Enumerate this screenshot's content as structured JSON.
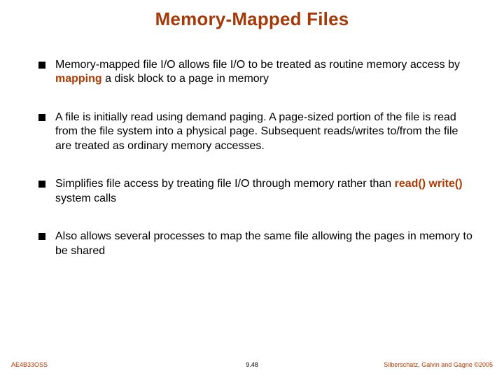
{
  "title": "Memory-Mapped Files",
  "bullets": {
    "b1a": "Memory-mapped file I/O allows file I/O to be treated as routine memory access by ",
    "b1kw": "mapping",
    "b1b": " a disk block to a page in memory",
    "b2": "A file is initially read using demand paging. A page-sized portion of the file is read from the file system into a physical page. Subsequent reads/writes to/from the file are treated as ordinary memory accesses.",
    "b3a": "Simplifies file access by treating file I/O through memory rather than ",
    "b3kw": "read() write()",
    "b3b": " system calls",
    "b4": "Also allows several processes to map the same file allowing the pages in memory to be shared"
  },
  "footer": {
    "left": "AE4B33OSS",
    "center": "9.48",
    "right": "Silberschatz, Galvin and Gagne ©2005"
  }
}
